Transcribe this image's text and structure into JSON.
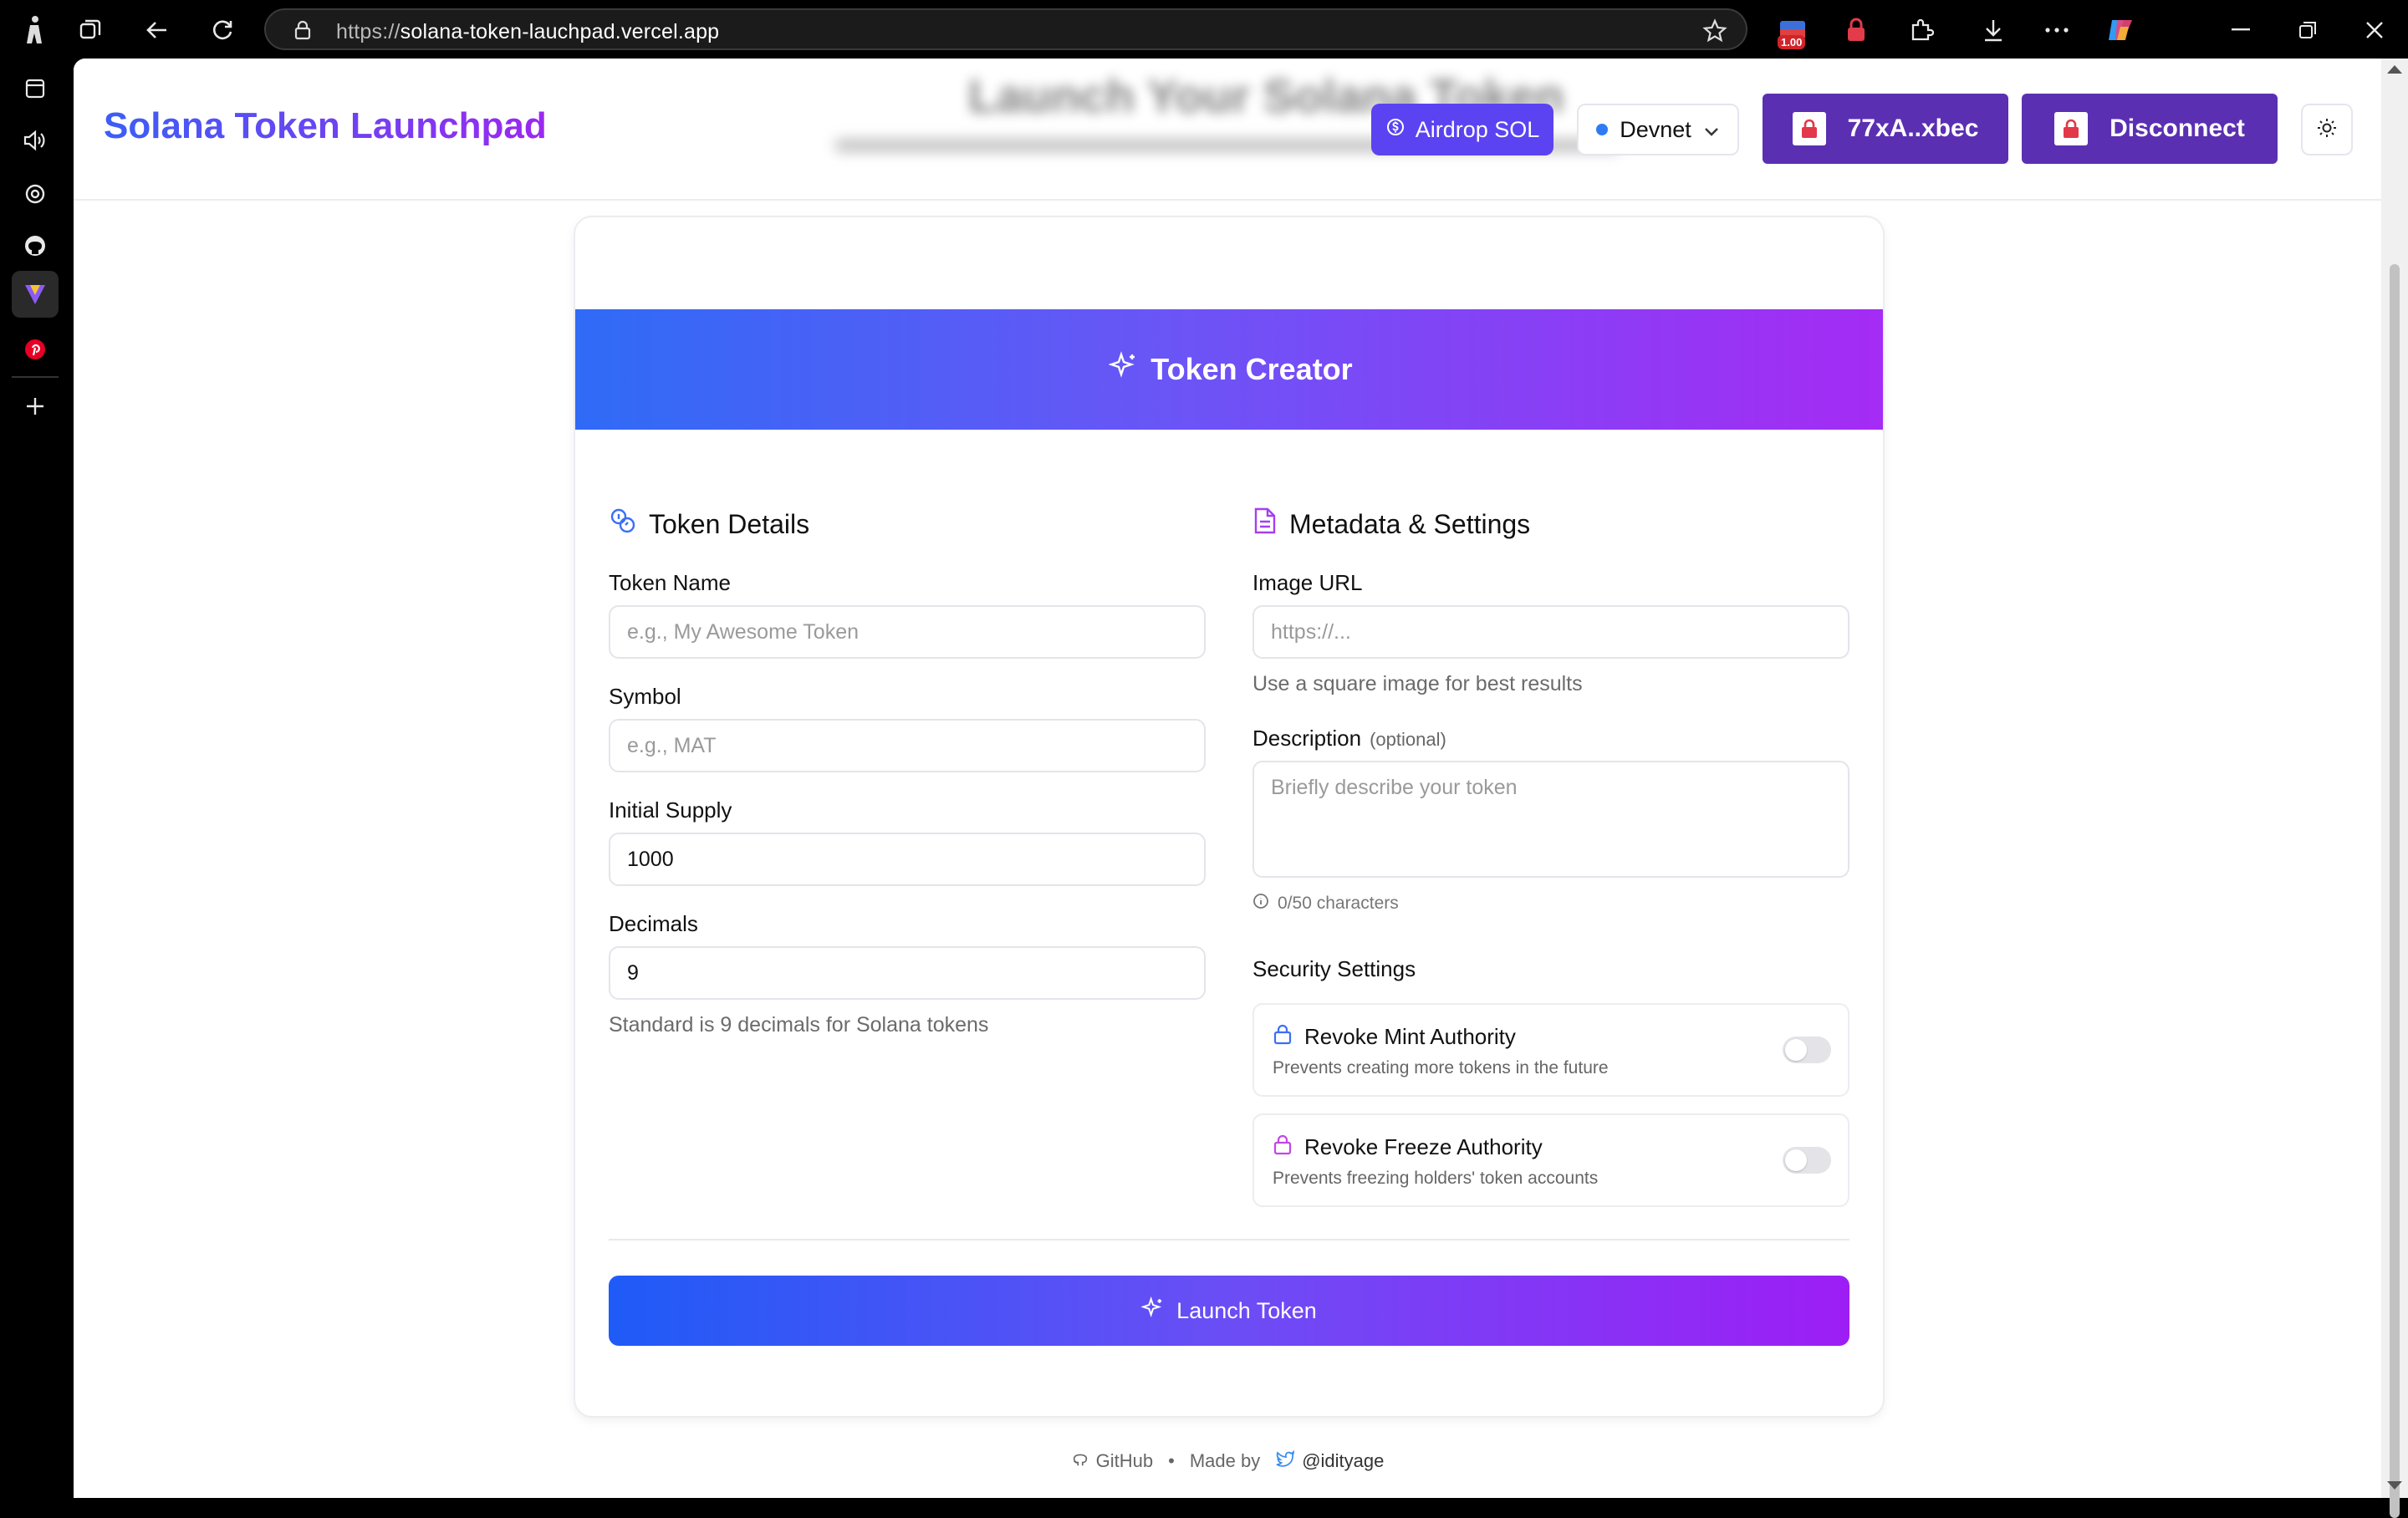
{
  "browser": {
    "url_prefix": "https://",
    "url_host": "solana-token-lauchpad.vercel.app",
    "tab_badge": "1.00"
  },
  "header": {
    "brand": "Solana Token Launchpad",
    "bg_title": "Launch Your Solana Token",
    "airdrop_label": "Airdrop SOL",
    "network_label": "Devnet",
    "wallet_label": "77xA..xbec",
    "disconnect_label": "Disconnect"
  },
  "card": {
    "title": "Token Creator",
    "token_details": {
      "title": "Token Details",
      "name_label": "Token Name",
      "name_placeholder": "e.g., My Awesome Token",
      "symbol_label": "Symbol",
      "symbol_placeholder": "e.g., MAT",
      "supply_label": "Initial Supply",
      "supply_value": "1000",
      "decimals_label": "Decimals",
      "decimals_value": "9",
      "decimals_hint": "Standard is 9 decimals for Solana tokens"
    },
    "metadata": {
      "title": "Metadata & Settings",
      "image_label": "Image URL",
      "image_placeholder": "https://...",
      "image_hint": "Use a square image for best results",
      "desc_label": "Description",
      "desc_optional": "(optional)",
      "desc_placeholder": "Briefly describe your token",
      "char_count": "0/50 characters",
      "security_label": "Security Settings",
      "revoke_mint_title": "Revoke Mint Authority",
      "revoke_mint_desc": "Prevents creating more tokens in the future",
      "revoke_freeze_title": "Revoke Freeze Authority",
      "revoke_freeze_desc": "Prevents freezing holders' token accounts"
    },
    "launch_label": "Launch Token"
  },
  "footer": {
    "github": "GitHub",
    "separator": "•",
    "made_by": "Made by",
    "handle": "@idityage"
  },
  "colors": {
    "brand_start": "#3b5ff5",
    "brand_end": "#9b28f0",
    "wallet_button": "#5b2fb1",
    "airdrop_button": "#5b43f2"
  }
}
